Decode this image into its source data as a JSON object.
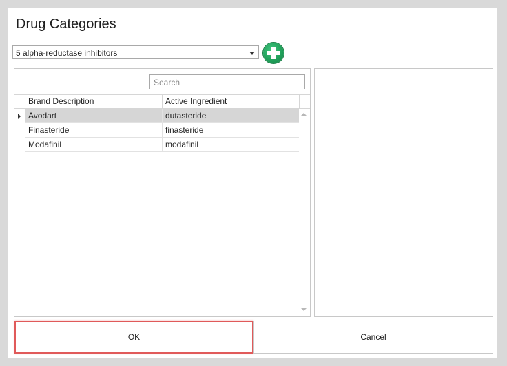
{
  "dialog": {
    "title": "Drug Categories"
  },
  "category_select": {
    "selected": "5 alpha-reductase inhibitors"
  },
  "add_button": {
    "icon": "plus-circle-icon",
    "color": "#1f9e58"
  },
  "search": {
    "placeholder": "Search"
  },
  "table": {
    "columns": [
      "Brand Description",
      "Active Ingredient"
    ],
    "rows": [
      {
        "brand": "Avodart",
        "ingredient": "dutasteride",
        "selected": true
      },
      {
        "brand": "Finasteride",
        "ingredient": "finasteride",
        "selected": false
      },
      {
        "brand": "Modafinil",
        "ingredient": "modafinil",
        "selected": false
      }
    ]
  },
  "buttons": {
    "ok": "OK",
    "cancel": "Cancel"
  },
  "colors": {
    "highlight_border": "#e05a5a",
    "selected_row": "#d6d6d6",
    "title_rule": "#8fb3c9"
  }
}
